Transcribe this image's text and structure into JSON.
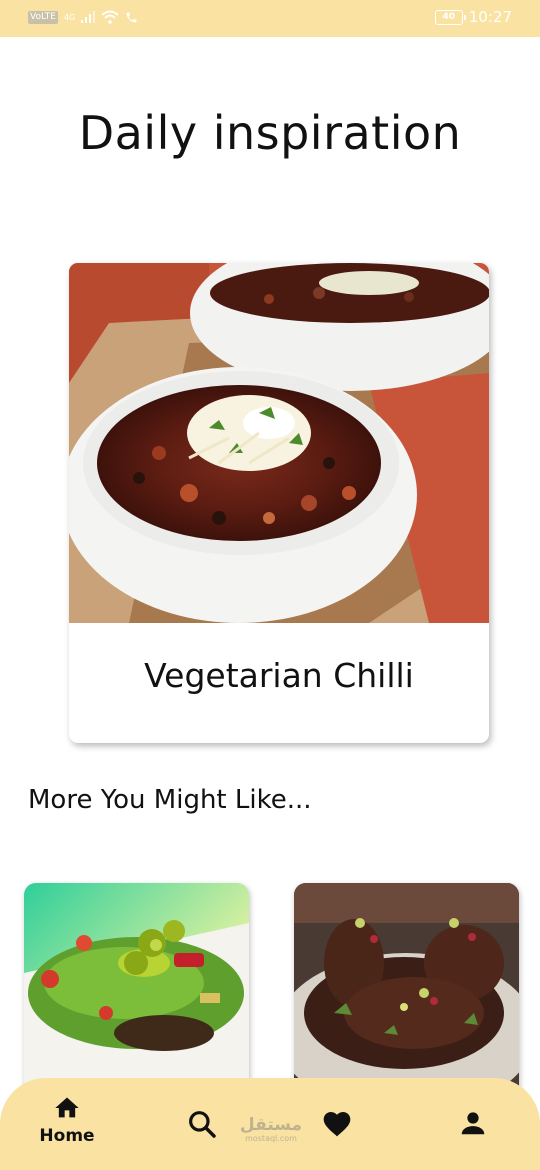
{
  "status_bar": {
    "network_tag": "VoLTE",
    "signal_text": "4G",
    "battery": "40",
    "time": "10:27"
  },
  "page": {
    "title": "Daily inspiration"
  },
  "featured": {
    "title": "Vegetarian Chilli"
  },
  "recommendations": {
    "heading": "More You Might Like..."
  },
  "bottom_nav": {
    "home_label": "Home",
    "items": [
      "home-icon",
      "search-icon",
      "heart-icon",
      "person-icon"
    ]
  },
  "watermark": {
    "arabic": "مستقل",
    "latin": "mostaql.com"
  },
  "colors": {
    "accent": "#f9e2a2",
    "text": "#111111",
    "background": "#ffffff"
  }
}
